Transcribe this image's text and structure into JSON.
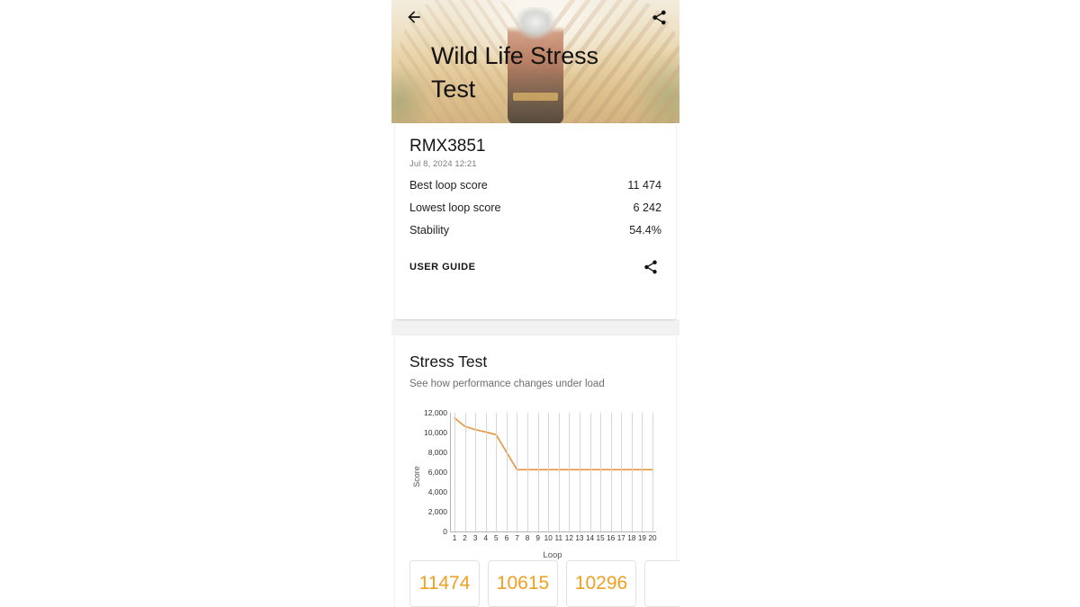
{
  "app": {
    "hero": {
      "title": "Wild Life Stress Test",
      "back_icon": "arrow-left-icon",
      "share_icon": "share-icon"
    }
  },
  "summary": {
    "device_name": "RMX3851",
    "timestamp": "Jul 8, 2024 12:21",
    "rows": [
      {
        "label": "Best loop score",
        "value": "11 474"
      },
      {
        "label": "Lowest loop score",
        "value": "6 242"
      },
      {
        "label": "Stability",
        "value": "54.4%"
      }
    ],
    "user_guide_label": "USER GUIDE",
    "share_icon": "share-icon"
  },
  "stress": {
    "title": "Stress Test",
    "subtitle": "See how performance changes under load"
  },
  "colors": {
    "line": "#e8933c",
    "chip_text": "#f0a020",
    "grid": "#d6d6d6",
    "axis": "#b5b5b5",
    "page_bg": "#f2f2f2"
  },
  "chart_data": {
    "type": "line",
    "title": "Stress Test",
    "xlabel": "Loop",
    "ylabel": "Score",
    "xlim": [
      1,
      20
    ],
    "ylim": [
      0,
      12000
    ],
    "grid": true,
    "legend": "none",
    "x": [
      1,
      2,
      3,
      4,
      5,
      6,
      7,
      8,
      9,
      10,
      11,
      12,
      13,
      14,
      15,
      16,
      17,
      18,
      19,
      20
    ],
    "xtick_labels": [
      "1",
      "2",
      "3",
      "4",
      "5",
      "6",
      "7",
      "8",
      "9",
      "10",
      "11",
      "12",
      "13",
      "14",
      "15",
      "16",
      "17",
      "18",
      "19",
      "20"
    ],
    "ytick_labels": [
      "0",
      "2,000",
      "4,000",
      "6,000",
      "8,000",
      "10,000",
      "12,000"
    ],
    "ytick_values": [
      0,
      2000,
      4000,
      6000,
      8000,
      10000,
      12000
    ],
    "series": [
      {
        "name": "Score",
        "color": "#e8933c",
        "values": [
          11474,
          10615,
          10296,
          10050,
          9780,
          8000,
          6242,
          6242,
          6242,
          6242,
          6242,
          6242,
          6242,
          6242,
          6242,
          6242,
          6242,
          6242,
          6242,
          6242
        ]
      }
    ]
  },
  "loop_scores": {
    "chips": [
      "11474",
      "10615",
      "10296",
      ""
    ]
  }
}
